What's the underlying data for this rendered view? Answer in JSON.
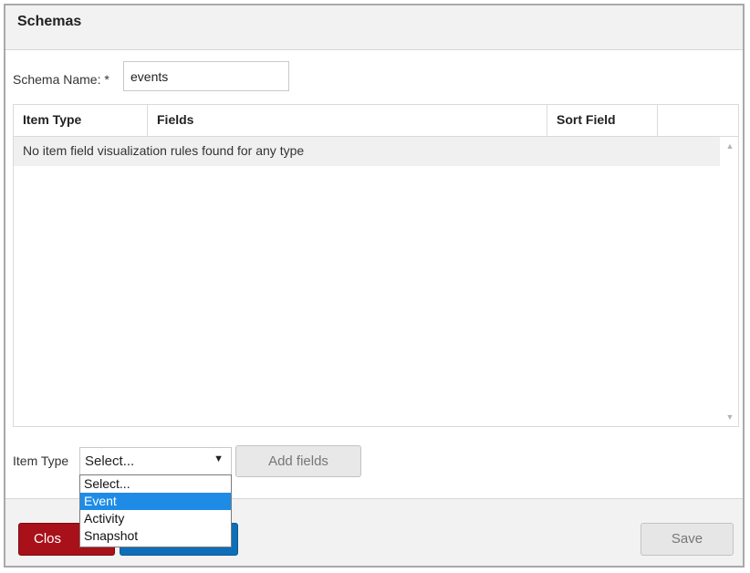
{
  "dialog": {
    "title": "Schemas"
  },
  "schema_name": {
    "label": "Schema Name: *",
    "value": "events"
  },
  "grid": {
    "columns": [
      "Item Type",
      "Fields",
      "Sort Field"
    ],
    "empty_message": "No item field visualization rules found for any type"
  },
  "item_type": {
    "label": "Item Type",
    "selected": "Select...",
    "options": [
      "Select...",
      "Event",
      "Activity",
      "Snapshot"
    ],
    "highlighted_option": "Event"
  },
  "buttons": {
    "add_fields": "Add fields",
    "close": "Clos",
    "save": "Save"
  },
  "icons": {
    "dropdown_arrow": "▼",
    "scroll_up": "▲",
    "scroll_down": "▼"
  },
  "colors": {
    "close_button": "#a8111a",
    "primary_button": "#0e6fb8",
    "highlight": "#1e8ce6"
  }
}
